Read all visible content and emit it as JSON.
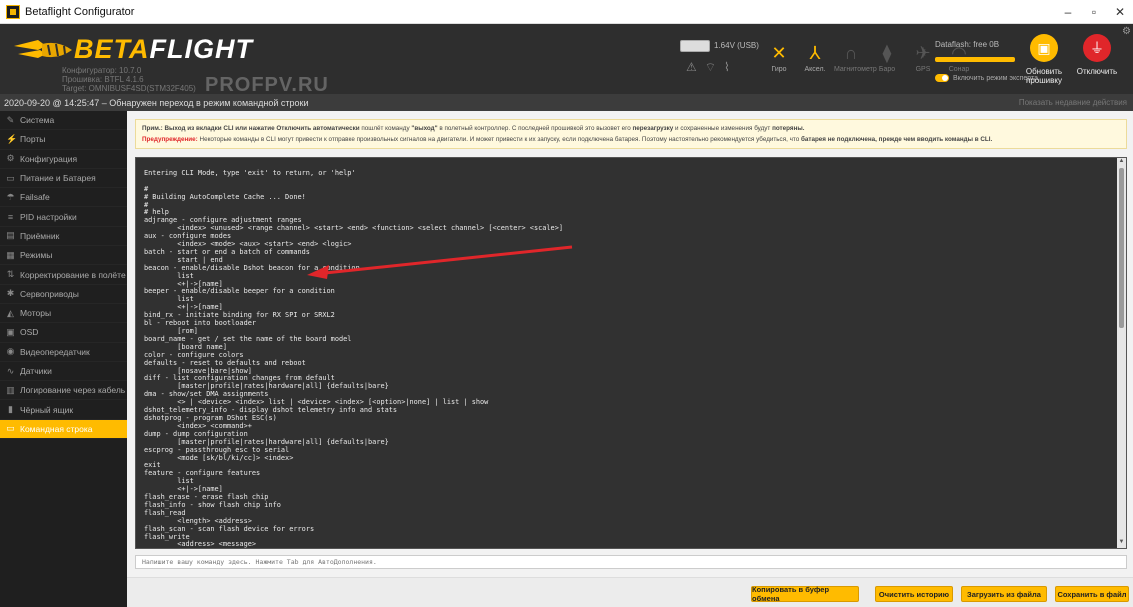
{
  "window": {
    "title": "Betaflight Configurator",
    "minimize": "–",
    "maximize": "▫",
    "close": "✕"
  },
  "header": {
    "brand_yellow": "BETA",
    "brand_white": "FLIGHT",
    "config_line": "Конфигуратор: 10.7.0",
    "firmware_line": "Прошивка: BTFL 4.1.6",
    "target_line": "Target: OMNIBUSF4SD(STM32F405)",
    "watermark": "PROFPV.RU",
    "battery_label": "1.64V (USB)",
    "dataflash_label": "Dataflash: free 0B",
    "expert_label": "Включить режим эксперта",
    "update_label": "Обновить прошивку",
    "disconnect_label": "Отключить",
    "sensors": [
      {
        "label": "Гиро",
        "active": true
      },
      {
        "label": "Аксел.",
        "active": true
      },
      {
        "label": "Магнитометр",
        "active": false
      },
      {
        "label": "Баро",
        "active": false
      },
      {
        "label": "GPS",
        "active": false
      },
      {
        "label": "Сонар",
        "active": false
      }
    ]
  },
  "status": {
    "message": "2020-09-20 @ 14:25:47 – Обнаружен переход в режим командной строки",
    "actions_link": "Показать недавние действия"
  },
  "sidebar": {
    "items": [
      {
        "label": "Система",
        "icon": "wrench-icon",
        "glyph": "✎"
      },
      {
        "label": "Порты",
        "icon": "plug-icon",
        "glyph": "⚡"
      },
      {
        "label": "Конфигурация",
        "icon": "gear-icon",
        "glyph": "⚙"
      },
      {
        "label": "Питание и Батарея",
        "icon": "battery-icon",
        "glyph": "▭"
      },
      {
        "label": "Failsafe",
        "icon": "parachute-icon",
        "glyph": "☂"
      },
      {
        "label": "PID настройки",
        "icon": "sliders-icon",
        "glyph": "≡"
      },
      {
        "label": "Приёмник",
        "icon": "receiver-icon",
        "glyph": "▤"
      },
      {
        "label": "Режимы",
        "icon": "modes-icon",
        "glyph": "▦"
      },
      {
        "label": "Корректирование в полёте",
        "icon": "adjust-icon",
        "glyph": "⇅"
      },
      {
        "label": "Сервоприводы",
        "icon": "servo-icon",
        "glyph": "✱"
      },
      {
        "label": "Моторы",
        "icon": "motor-icon",
        "glyph": "◭"
      },
      {
        "label": "OSD",
        "icon": "osd-icon",
        "glyph": "▣"
      },
      {
        "label": "Видеопередатчик",
        "icon": "vtx-icon",
        "glyph": "◉"
      },
      {
        "label": "Датчики",
        "icon": "sensors-icon",
        "glyph": "∿"
      },
      {
        "label": "Логирование через кабель",
        "icon": "log-icon",
        "glyph": "▥"
      },
      {
        "label": "Чёрный ящик",
        "icon": "blackbox-icon",
        "glyph": "▮"
      },
      {
        "label": "Командная строка",
        "icon": "cli-icon",
        "glyph": "▭",
        "active": true
      }
    ]
  },
  "note": {
    "line1_a": "Прим.: Выход из вкладки CLI или нажатие Отключить ",
    "line1_b": "автоматически",
    "line1_c": " пошлёт команду ",
    "line1_d": "\"выход\"",
    "line1_e": " в полетный контроллер. С последней прошивкой это вызовет его ",
    "line1_f": "перезагрузку",
    "line1_g": " и сохраненные изменения будут ",
    "line1_h": "потеряны.",
    "line2_a": "Предупреждение:",
    "line2_b": " Некоторые команды в CLI могут привести к отправке произвольных сигналов на двигатели. И может привести к их запуску, если подключена батарея. Поэтому настоятельно рекомендуется убедиться, что ",
    "line2_c": "батарея не подключена, прежде чем вводить команды в CLI."
  },
  "terminal": {
    "lines": [
      "",
      "Entering CLI Mode, type 'exit' to return, or 'help'",
      "",
      "#",
      "# Building AutoComplete Cache ... Done!",
      "#",
      "# help",
      "adjrange - configure adjustment ranges",
      "        <index> <unused> <range channel> <start> <end> <function> <select channel> [<center> <scale>]",
      "aux - configure modes",
      "        <index> <mode> <aux> <start> <end> <logic>",
      "batch - start or end a batch of commands",
      "        start | end",
      "beacon - enable/disable Dshot beacon for a condition",
      "        list",
      "        <+|->[name]",
      "beeper - enable/disable beeper for a condition",
      "        list",
      "        <+|->[name]",
      "bind_rx - initiate binding for RX SPI or SRXL2",
      "bl - reboot into bootloader",
      "        [rom]",
      "board_name - get / set the name of the board model",
      "        [board name]",
      "color - configure colors",
      "defaults - reset to defaults and reboot",
      "        [nosave|bare|show]",
      "diff - list configuration changes from default",
      "        [master|profile|rates|hardware|all] {defaults|bare}",
      "dma - show/set DMA assignments",
      "        <> | <device> <index> list | <device> <index> [<option>|none] | list | show",
      "dshot_telemetry_info - display dshot telemetry info and stats",
      "dshotprog - program DShot ESC(s)",
      "        <index> <command>+",
      "dump - dump configuration",
      "        [master|profile|rates|hardware|all] {defaults|bare}",
      "escprog - passthrough esc to serial",
      "        <mode [sk/bl/ki/cc]> <index>",
      "exit",
      "feature - configure features",
      "        list",
      "        <+|->[name]",
      "flash_erase - erase flash chip",
      "flash_info - show flash chip info",
      "flash_read",
      "        <length> <address>",
      "flash_scan - scan flash device for errors",
      "flash_write",
      "        <address> <message>"
    ]
  },
  "input": {
    "placeholder": "Напишите вашу команду здесь. Нажмите Tab для АвтоДополнения."
  },
  "toolbar": {
    "copy_label": "Копировать в буфер обмена",
    "clear_label": "Очистить историю",
    "load_label": "Загрузить из файла",
    "save_label": "Сохранить в файл"
  },
  "colors": {
    "accent": "#ffbb00",
    "danger": "#e0262a",
    "terminal_bg": "#313131"
  }
}
